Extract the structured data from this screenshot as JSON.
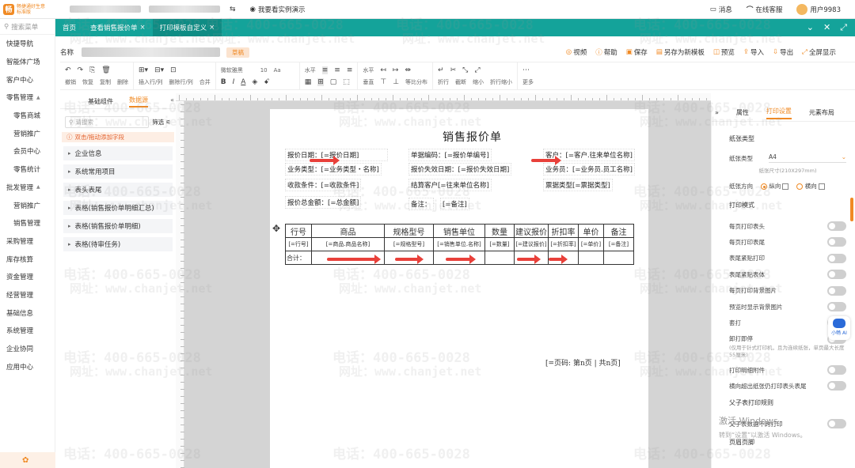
{
  "topbar": {
    "logo_text": "畅捷通好生意",
    "logo_sub": "标准版",
    "demo_label": "我要看实例演示",
    "messages": "消息",
    "service": "在线客服",
    "user": "用户9983"
  },
  "nav": {
    "search_placeholder": "搜索菜单",
    "items": [
      {
        "label": "快捷导航",
        "sub": false
      },
      {
        "label": "智能体广场",
        "sub": false
      },
      {
        "label": "客户中心",
        "sub": false
      },
      {
        "label": "零售管理",
        "sub": false,
        "expanded": true
      },
      {
        "label": "零售商城",
        "sub": true
      },
      {
        "label": "营销推广",
        "sub": true
      },
      {
        "label": "会员中心",
        "sub": true
      },
      {
        "label": "零售统计",
        "sub": true
      },
      {
        "label": "批发管理",
        "sub": false,
        "expanded": true
      },
      {
        "label": "营销推广",
        "sub": true
      },
      {
        "label": "销售管理",
        "sub": true
      },
      {
        "label": "采购管理",
        "sub": false
      },
      {
        "label": "库存核算",
        "sub": false
      },
      {
        "label": "资金管理",
        "sub": false
      },
      {
        "label": "经营管理",
        "sub": false
      },
      {
        "label": "基础信息",
        "sub": false
      },
      {
        "label": "系统管理",
        "sub": false
      },
      {
        "label": "企业协同",
        "sub": false
      },
      {
        "label": "应用中心",
        "sub": false
      }
    ]
  },
  "tabs": [
    {
      "label": "首页",
      "closable": false,
      "active": false
    },
    {
      "label": "查看销售报价单",
      "closable": true,
      "active": false
    },
    {
      "label": "打印模板自定义",
      "closable": true,
      "active": true
    }
  ],
  "row1": {
    "name_label": "名称",
    "badge": "草稿",
    "actions": [
      "视频",
      "帮助",
      "保存",
      "另存为新模板",
      "预览",
      "导入",
      "导出",
      "全屏显示"
    ]
  },
  "toolbar": {
    "undo": "撤销",
    "redo": "恢复",
    "copy": "复制",
    "delete": "删除",
    "insert_rowcol": "插入行/列",
    "delete_rowcol": "删除行/列",
    "merge": "合并",
    "font": "微软雅黑",
    "size": "10",
    "horizontal": "水平",
    "vertical": "垂直",
    "pct_distribute": "等比分布",
    "wrap": "折行",
    "truncate": "截断",
    "shrink": "缩小",
    "wrap_shrink": "折行缩小",
    "more": "更多"
  },
  "left_panel": {
    "tabs": [
      "基础组件",
      "数据源"
    ],
    "active_tab": "数据源",
    "search_placeholder": "请搜索",
    "filter": "筛选",
    "hint": "双击/拖动添加字段",
    "nodes": [
      "企业信息",
      "系统常用项目",
      "表头表尾",
      "表格(销售报价单明细汇总)",
      "表格(销售报价单明细)",
      "表格(待审任务)"
    ]
  },
  "paper": {
    "title": "销售报价单",
    "fields": [
      "报价日期：[=报价日期]",
      "单据编码：[=报价单编号]",
      "客户：[=客户.往来单位名称]",
      "业务类型：[=业务类型・名称]",
      "报价失效日期：[=报价失效日期]",
      "业务员：[=业务员.员工名称]",
      "收款条件：[=收款条件]",
      "结算客户[=往来单位名称]",
      "票据类型[=票据类型]",
      "报价总金额：[=总金额]",
      "备注：",
      "[=备注]"
    ],
    "table_headers": [
      "行号",
      "商品",
      "规格型号",
      "销售单位",
      "数量",
      "建议报价",
      "折扣率",
      "单价",
      "备注"
    ],
    "table_row": [
      "[=行号]",
      "[=商品.商品名称]",
      "[=规格型号]",
      "[=销售单位.名称]",
      "[=数量]",
      "[=建议报价]",
      "[=折扣率]",
      "[=单价]",
      "[=备注]"
    ],
    "total_label": "合计：",
    "page_code": "[=页码: 第n页 | 共n页]"
  },
  "right_panel": {
    "tabs": [
      "属性",
      "打印设置",
      "元素布局"
    ],
    "active_tab": "打印设置",
    "paper_type_section": "纸张类型",
    "paper_type_label": "纸张类型",
    "paper_type_value": "A4",
    "paper_size": "纸张尺寸(210X297mm)",
    "orientation_label": "纸张方向",
    "orientation_portrait": "纵向",
    "orientation_landscape": "横向",
    "print_mode_section": "打印模式",
    "toggles": [
      "每页打印表头",
      "每页打印表尾",
      "表尾紧贴打印",
      "表尾紧贴表体",
      "每页打印背景图片",
      "预览时显示背景图片",
      "套打",
      "卸打即停"
    ],
    "continuous_note": "(仅用于针式打印机，且为连续纸张，单页最大长度55厘米)",
    "toggles2": [
      "打印明细附件",
      "横向超出纸张仍打印表头表尾"
    ],
    "parent_child_section": "父子表打印规则",
    "parent_child_toggle": "父子表数据不跨打印",
    "footer_section": "页眉页脚"
  },
  "robot_label": "小畅 AI",
  "windows_activation": "激活 Windows",
  "windows_activation_sub": "转到“设置”以激活 Windows。",
  "watermark_phone": "电话：400-665-0028",
  "watermark_site": "网址：www.chanjet.net",
  "colors": {
    "teal": "#14a39a",
    "orange": "#f08a24",
    "arrow": "#e8403a"
  }
}
